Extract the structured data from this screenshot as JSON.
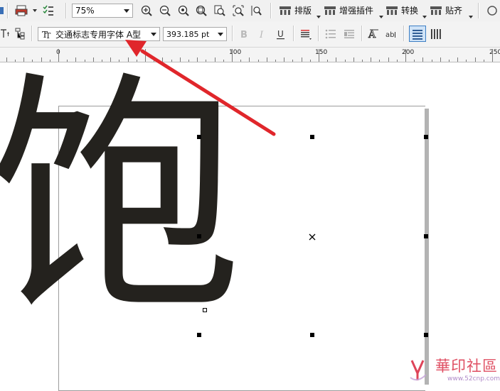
{
  "toolbar_top": {
    "zoom_value": "75%",
    "plugins": [
      {
        "label": "排版"
      },
      {
        "label": "增强插件"
      },
      {
        "label": "转换"
      },
      {
        "label": "贴齐"
      }
    ]
  },
  "toolbar_text": {
    "font_family": "交通标志专用字体 A型",
    "font_size": "393.185 pt"
  },
  "ruler": {
    "labels": [
      "0",
      "100",
      "150",
      "200",
      "250"
    ]
  },
  "canvas": {
    "glyph": "饱",
    "watermark_brand": "華印社區",
    "watermark_url": "www.52cnp.com"
  },
  "colors": {
    "annotation_arrow": "#e0262b",
    "glyph": "#24221e",
    "watermark": "#d8233c"
  },
  "icons": [
    "print-icon",
    "checklist-icon",
    "zoom-in-icon",
    "zoom-out-icon",
    "zoom-fit-icon",
    "zoom-selection-icon",
    "zoom-page-icon",
    "zoom-width-icon",
    "zoom-height-icon",
    "bold-icon",
    "italic-icon",
    "underline-icon",
    "align-icon",
    "bullet-list-icon",
    "drop-cap-icon",
    "text-frame-icon",
    "horizontal-text-icon",
    "vertical-text-icon"
  ]
}
